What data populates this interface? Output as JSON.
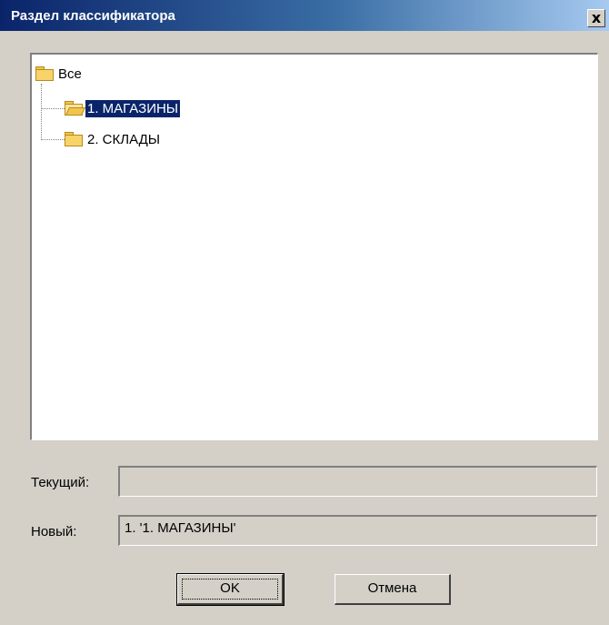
{
  "window": {
    "title": "Раздел классификатора",
    "close_label": "x"
  },
  "tree": {
    "root": {
      "label": "Все",
      "icon": "folder-closed-icon"
    },
    "children": [
      {
        "label": "1. МАГАЗИНЫ",
        "icon": "folder-open-icon",
        "selected": true
      },
      {
        "label": "2. СКЛАДЫ",
        "icon": "folder-closed-icon",
        "selected": false
      }
    ]
  },
  "fields": {
    "current": {
      "label": "Текущий:",
      "value": ""
    },
    "new": {
      "label": "Новый:",
      "value": "1. '1. МАГАЗИНЫ'"
    }
  },
  "buttons": {
    "ok": "OK",
    "cancel": "Отмена"
  },
  "colors": {
    "titlebar_start": "#0a246a",
    "titlebar_end": "#a6caf0",
    "selection": "#0a246a",
    "dialog_bg": "#d4d0c8"
  }
}
